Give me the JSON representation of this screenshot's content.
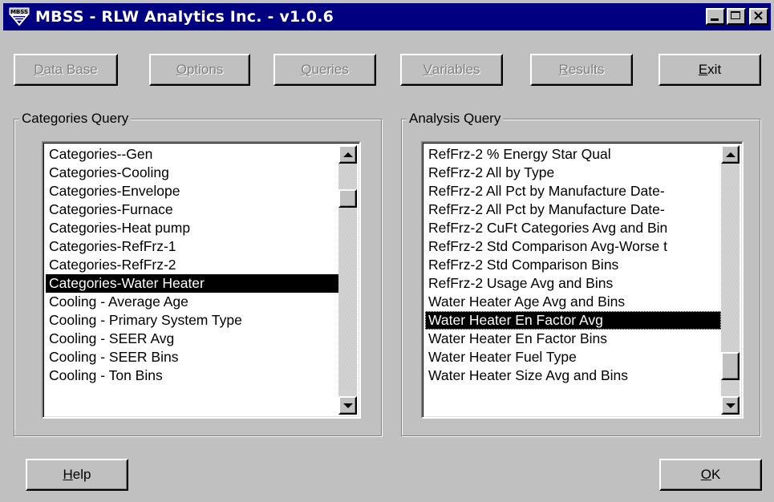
{
  "window": {
    "title": "MBSS - RLW Analytics Inc. - v1.0.6",
    "app_icon": "mbss-logo-icon"
  },
  "toolbar": {
    "database": {
      "label_accel": "D",
      "label_rest": "ata Base",
      "enabled": false
    },
    "options": {
      "label_accel": "O",
      "label_rest": "ptions",
      "enabled": false
    },
    "queries": {
      "label_accel": "Q",
      "label_rest": "ueries",
      "enabled": false
    },
    "variables": {
      "label_accel": "V",
      "label_rest": "ariables",
      "enabled": false
    },
    "results": {
      "label_accel": "R",
      "label_rest": "esults",
      "enabled": false
    },
    "exit": {
      "label_accel": "E",
      "label_rest": "xit",
      "enabled": true
    }
  },
  "categories_query": {
    "label": "Categories Query",
    "items": [
      "Categories--Gen",
      "Categories-Cooling",
      "Categories-Envelope",
      "Categories-Furnace",
      "Categories-Heat pump",
      "Categories-RefFrz-1",
      "Categories-RefFrz-2",
      "Categories-Water Heater",
      "Cooling - Average Age",
      "Cooling - Primary System Type",
      "Cooling - SEER Avg",
      "Cooling - SEER Bins",
      "Cooling - Ton Bins"
    ],
    "selected_index": 7,
    "scroll_position": 0.12
  },
  "analysis_query": {
    "label": "Analysis Query",
    "items": [
      "RefFrz-2 % Energy Star Qual",
      "RefFrz-2 All by Type",
      "RefFrz-2 All Pct by Manufacture Date-",
      "RefFrz-2 All Pct by Manufacture Date-",
      "RefFrz-2 CuFt Categories Avg and Bin",
      "RefFrz-2 Std Comparison Avg-Worse t",
      "RefFrz-2 Std Comparison Bins",
      "RefFrz-2 Usage Avg and Bins",
      "Water Heater Age Avg and Bins",
      "Water Heater En Factor Avg",
      "Water Heater En Factor Bins",
      "Water Heater Fuel Type",
      "Water Heater Size Avg and Bins"
    ],
    "selected_index": 9,
    "scroll_position": 0.92
  },
  "footer": {
    "help": {
      "label_accel": "H",
      "label_rest": "elp"
    },
    "ok": {
      "label_accel": "O",
      "label_rest": "K"
    }
  },
  "colors": {
    "titlebar": "#000080",
    "face": "#c0c0c0",
    "selection": "#000000"
  }
}
